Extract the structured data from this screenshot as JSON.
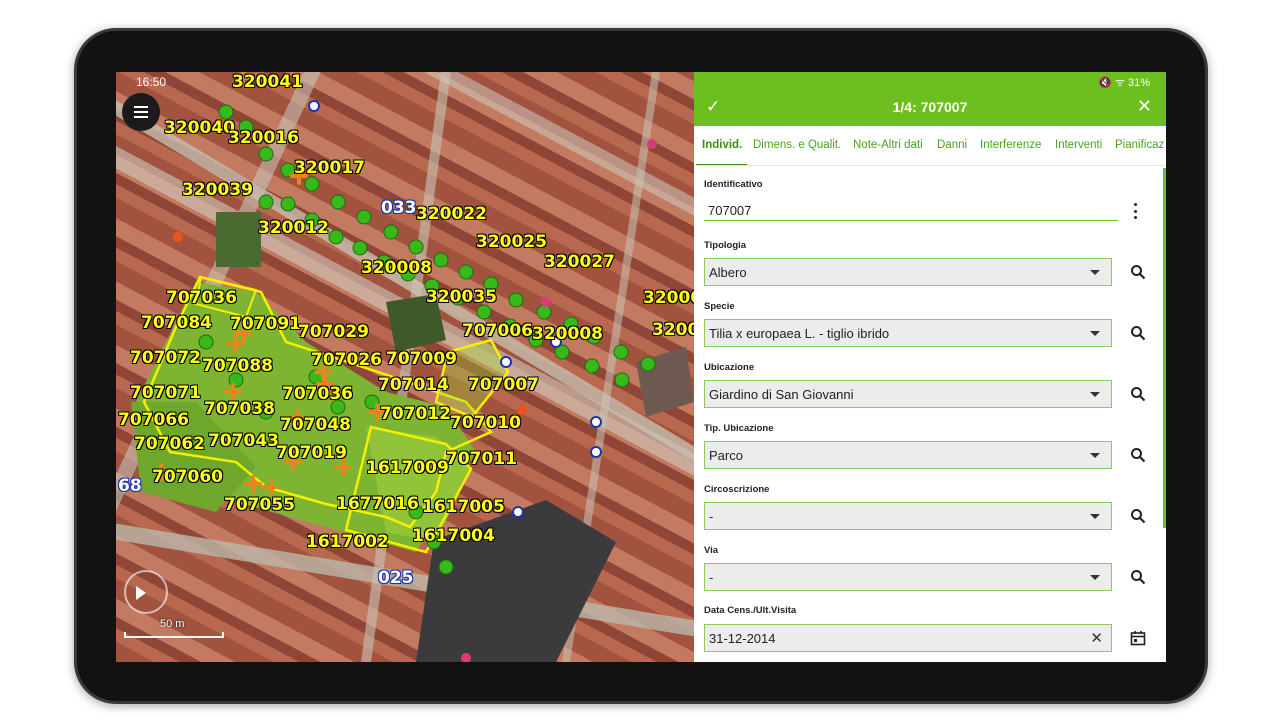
{
  "status": {
    "time": "16:50",
    "icons": "🔇 ᯤ",
    "battery": "31%"
  },
  "map": {
    "scale_label": "50 m",
    "labels": [
      {
        "text": "320041",
        "color": "yellow"
      },
      {
        "text": "320040",
        "color": "yellow"
      },
      {
        "text": "320016",
        "color": "yellow"
      },
      {
        "text": "320017",
        "color": "yellow"
      },
      {
        "text": "320039",
        "color": "yellow"
      },
      {
        "text": "033",
        "color": "blue"
      },
      {
        "text": "320022",
        "color": "yellow"
      },
      {
        "text": "320012",
        "color": "yellow"
      },
      {
        "text": "320025",
        "color": "yellow"
      },
      {
        "text": "320027",
        "color": "yellow"
      },
      {
        "text": "320008",
        "color": "yellow"
      },
      {
        "text": "320035",
        "color": "yellow"
      },
      {
        "text": "707036",
        "color": "yellow"
      },
      {
        "text": "32000",
        "color": "yellow"
      },
      {
        "text": "707084",
        "color": "yellow"
      },
      {
        "text": "707091",
        "color": "yellow"
      },
      {
        "text": "707029",
        "color": "yellow"
      },
      {
        "text": "707006",
        "color": "yellow"
      },
      {
        "text": "320008",
        "color": "yellow"
      },
      {
        "text": "3200",
        "color": "yellow"
      },
      {
        "text": "707072",
        "color": "yellow"
      },
      {
        "text": "707088",
        "color": "yellow"
      },
      {
        "text": "707026",
        "color": "yellow"
      },
      {
        "text": "707009",
        "color": "yellow"
      },
      {
        "text": "707071",
        "color": "yellow"
      },
      {
        "text": "707036",
        "color": "yellow"
      },
      {
        "text": "707014",
        "color": "yellow"
      },
      {
        "text": "707007",
        "color": "yellow"
      },
      {
        "text": "707066",
        "color": "yellow"
      },
      {
        "text": "707038",
        "color": "yellow"
      },
      {
        "text": "707012",
        "color": "yellow"
      },
      {
        "text": "707048",
        "color": "yellow"
      },
      {
        "text": "707010",
        "color": "yellow"
      },
      {
        "text": "707062",
        "color": "yellow"
      },
      {
        "text": "707043",
        "color": "yellow"
      },
      {
        "text": "707019",
        "color": "yellow"
      },
      {
        "text": "707011",
        "color": "yellow"
      },
      {
        "text": "1617009",
        "color": "yellow"
      },
      {
        "text": "707060",
        "color": "yellow"
      },
      {
        "text": "68",
        "color": "blue"
      },
      {
        "text": "707055",
        "color": "yellow"
      },
      {
        "text": "1677016",
        "color": "yellow"
      },
      {
        "text": "1617005",
        "color": "yellow"
      },
      {
        "text": "1617004",
        "color": "yellow"
      },
      {
        "text": "1617002",
        "color": "yellow"
      },
      {
        "text": "025",
        "color": "blue"
      }
    ]
  },
  "panel": {
    "title": "1/4: 707007",
    "confirm_icon": "✓",
    "close_icon": "✕",
    "tabs": [
      "Individ.",
      "Dimens. e Qualit.",
      "Note-Altri dati",
      "Danni",
      "Interferenze",
      "Interventi",
      "Pianificaz"
    ],
    "identificativo": {
      "label": "Identificativo",
      "value": "707007"
    },
    "fields": [
      {
        "label": "Tipologia",
        "value": "Albero",
        "icon": "search-icon"
      },
      {
        "label": "Specie",
        "value": "Tilia x europaea L. - tiglio ibrido",
        "icon": "search-icon"
      },
      {
        "label": "Ubicazione",
        "value": "Giardino di San Giovanni",
        "icon": "search-icon"
      },
      {
        "label": "Tip. Ubicazione",
        "value": "Parco",
        "icon": "search-icon"
      },
      {
        "label": "Circoscrizione",
        "value": "-",
        "icon": "search-icon"
      },
      {
        "label": "Via",
        "value": "-",
        "icon": "search-icon"
      }
    ],
    "date_field": {
      "label": "Data Cens./Ult.Visita",
      "value": "31-12-2014",
      "clear_icon": "✕",
      "icon": "calendar-icon"
    }
  },
  "colors": {
    "accent": "#6cbf1e",
    "accent_dark": "#3f8f0f",
    "label_yellow": "#ffff1a",
    "polygon_stroke": "#f5f000",
    "tree_green": "#39b81a",
    "marker_orange": "#e8861e"
  }
}
